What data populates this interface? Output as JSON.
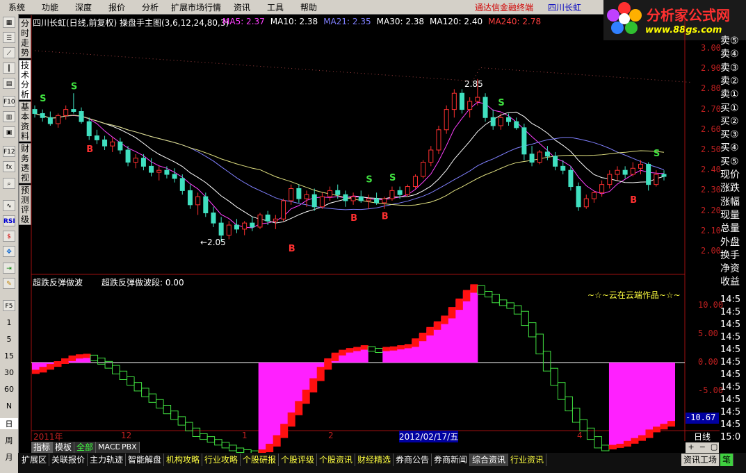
{
  "menu": [
    "系统",
    "功能",
    "深度",
    "报价",
    "分析",
    "扩展市场行情",
    "资讯",
    "工具",
    "帮助"
  ],
  "broker": "通达信金融终端",
  "stock_name": "四川长虹",
  "logo": {
    "title": "分析家公式网",
    "url": "www.88gs.com"
  },
  "main_header": {
    "title": "四川长虹(日线,前复权) 操盘手主图(3,6,12,24,80,3)",
    "ma": [
      {
        "label": "MA5: 2.37",
        "color": "#ff40ff"
      },
      {
        "label": "MA10: 2.38",
        "color": "#ffffff"
      },
      {
        "label": "MA21: 2.35",
        "color": "#8080ff"
      },
      {
        "label": "MA30: 2.38",
        "color": "#ffffff"
      },
      {
        "label": "MA120: 2.40",
        "color": "#ffffff"
      },
      {
        "label": "MA240: 2.78",
        "color": "#ff4040"
      }
    ]
  },
  "annotations": {
    "high": "2.85",
    "low": "←2.05"
  },
  "sub_header": {
    "name": "超跌反弹做波",
    "value_label": "超跌反弹做波段: 0.00",
    "watermark": "~☆~云在云端作品~☆~"
  },
  "price_axis": [
    "3.00",
    "2.90",
    "2.80",
    "2.70",
    "2.60",
    "2.50",
    "2.40",
    "2.30",
    "2.20",
    "2.10",
    "2.00"
  ],
  "sub_axis": [
    "10.00",
    "5.00",
    "0.00",
    "-5.00"
  ],
  "sub_axis_current": "-10.67",
  "dates": {
    "year": "2011年",
    "m12": "12",
    "m1": "1",
    "m2": "2",
    "cursor": "2012/02/17/五",
    "m4": "4"
  },
  "period": "日线",
  "right_side": [
    "卖⑤",
    "卖④",
    "卖③",
    "卖②",
    "卖①",
    "买①",
    "买②",
    "买③",
    "买④",
    "买⑤",
    "现价",
    "涨跌",
    "涨幅",
    "现量",
    "总量",
    "外盘",
    "换手",
    "净资",
    "收益"
  ],
  "right_time": [
    "14:5",
    "14:5",
    "14:5",
    "14:5",
    "14:5",
    "14:5",
    "14:5",
    "14:5",
    "14:5",
    "14:5",
    "14:5",
    "15:0"
  ],
  "vtabs": [
    "分时走势",
    "技术分析",
    "基本资料",
    "财务透视",
    "预测评级"
  ],
  "tb_nums": [
    "1",
    "5",
    "15",
    "30",
    "60",
    "N",
    "日",
    "周",
    "月"
  ],
  "ind_tabs": [
    "指标",
    "模板",
    "全部",
    "MACD",
    "PBX"
  ],
  "bottom_tabs": [
    "扩展区",
    "关联报价",
    "主力轨迹",
    "智能解盘",
    "机构攻略",
    "行业攻略",
    "个股研报",
    "个股评级",
    "个股资讯",
    "财经精选",
    "券商公告",
    "券商新闻",
    "综合资讯",
    "行业资讯"
  ],
  "bottom_right": "资讯工场",
  "bottom_right2": "笔",
  "candles": [
    [
      2.7,
      2.72,
      2.66,
      2.68
    ],
    [
      2.68,
      2.7,
      2.64,
      2.66
    ],
    [
      2.66,
      2.69,
      2.62,
      2.63
    ],
    [
      2.63,
      2.68,
      2.61,
      2.67
    ],
    [
      2.67,
      2.72,
      2.65,
      2.7
    ],
    [
      2.7,
      2.78,
      2.68,
      2.69
    ],
    [
      2.69,
      2.71,
      2.63,
      2.64
    ],
    [
      2.64,
      2.66,
      2.55,
      2.57
    ],
    [
      2.57,
      2.6,
      2.53,
      2.55
    ],
    [
      2.55,
      2.57,
      2.5,
      2.52
    ],
    [
      2.52,
      2.56,
      2.49,
      2.54
    ],
    [
      2.54,
      2.56,
      2.48,
      2.5
    ],
    [
      2.5,
      2.52,
      2.42,
      2.44
    ],
    [
      2.44,
      2.48,
      2.41,
      2.46
    ],
    [
      2.46,
      2.48,
      2.4,
      2.42
    ],
    [
      2.42,
      2.46,
      2.37,
      2.39
    ],
    [
      2.39,
      2.42,
      2.35,
      2.4
    ],
    [
      2.4,
      2.42,
      2.36,
      2.38
    ],
    [
      2.38,
      2.41,
      2.34,
      2.36
    ],
    [
      2.36,
      2.38,
      2.28,
      2.3
    ],
    [
      2.3,
      2.33,
      2.21,
      2.23
    ],
    [
      2.23,
      2.29,
      2.18,
      2.27
    ],
    [
      2.27,
      2.29,
      2.17,
      2.19
    ],
    [
      2.19,
      2.22,
      2.12,
      2.14
    ],
    [
      2.14,
      2.17,
      2.05,
      2.08
    ],
    [
      2.08,
      2.15,
      2.06,
      2.13
    ],
    [
      2.13,
      2.16,
      2.09,
      2.11
    ],
    [
      2.11,
      2.15,
      2.08,
      2.14
    ],
    [
      2.14,
      2.17,
      2.1,
      2.12
    ],
    [
      2.12,
      2.19,
      2.11,
      2.18
    ],
    [
      2.18,
      2.2,
      2.13,
      2.15
    ],
    [
      2.15,
      2.18,
      2.11,
      2.16
    ],
    [
      2.16,
      2.26,
      2.15,
      2.25
    ],
    [
      2.25,
      2.33,
      2.23,
      2.31
    ],
    [
      2.31,
      2.33,
      2.24,
      2.26
    ],
    [
      2.26,
      2.3,
      2.22,
      2.28
    ],
    [
      2.28,
      2.31,
      2.2,
      2.22
    ],
    [
      2.22,
      2.29,
      2.21,
      2.27
    ],
    [
      2.27,
      2.32,
      2.25,
      2.3
    ],
    [
      2.3,
      2.33,
      2.26,
      2.28
    ],
    [
      2.28,
      2.3,
      2.22,
      2.25
    ],
    [
      2.25,
      2.29,
      2.23,
      2.27
    ],
    [
      2.27,
      2.3,
      2.24,
      2.25
    ],
    [
      2.25,
      2.28,
      2.21,
      2.26
    ],
    [
      2.26,
      2.29,
      2.23,
      2.24
    ],
    [
      2.24,
      2.27,
      2.21,
      2.26
    ],
    [
      2.26,
      2.32,
      2.25,
      2.3
    ],
    [
      2.3,
      2.32,
      2.26,
      2.28
    ],
    [
      2.28,
      2.33,
      2.27,
      2.32
    ],
    [
      2.32,
      2.38,
      2.31,
      2.37
    ],
    [
      2.37,
      2.45,
      2.36,
      2.44
    ],
    [
      2.44,
      2.52,
      2.42,
      2.5
    ],
    [
      2.5,
      2.62,
      2.48,
      2.6
    ],
    [
      2.6,
      2.72,
      2.58,
      2.7
    ],
    [
      2.7,
      2.8,
      2.66,
      2.78
    ],
    [
      2.78,
      2.8,
      2.68,
      2.7
    ],
    [
      2.7,
      2.76,
      2.66,
      2.74
    ],
    [
      2.74,
      2.85,
      2.72,
      2.76
    ],
    [
      2.76,
      2.78,
      2.64,
      2.66
    ],
    [
      2.66,
      2.7,
      2.6,
      2.62
    ],
    [
      2.62,
      2.68,
      2.6,
      2.66
    ],
    [
      2.66,
      2.68,
      2.62,
      2.64
    ],
    [
      2.64,
      2.66,
      2.6,
      2.61
    ],
    [
      2.61,
      2.63,
      2.45,
      2.48
    ],
    [
      2.48,
      2.52,
      2.42,
      2.44
    ],
    [
      2.44,
      2.5,
      2.43,
      2.49
    ],
    [
      2.49,
      2.52,
      2.45,
      2.47
    ],
    [
      2.47,
      2.49,
      2.4,
      2.42
    ],
    [
      2.42,
      2.45,
      2.38,
      2.4
    ],
    [
      2.4,
      2.42,
      2.3,
      2.32
    ],
    [
      2.32,
      2.34,
      2.2,
      2.22
    ],
    [
      2.22,
      2.28,
      2.21,
      2.26
    ],
    [
      2.26,
      2.3,
      2.24,
      2.29
    ],
    [
      2.29,
      2.35,
      2.27,
      2.33
    ],
    [
      2.33,
      2.4,
      2.31,
      2.38
    ],
    [
      2.38,
      2.42,
      2.35,
      2.4
    ],
    [
      2.4,
      2.42,
      2.36,
      2.38
    ],
    [
      2.38,
      2.44,
      2.37,
      2.41
    ],
    [
      2.41,
      2.45,
      2.38,
      2.43
    ],
    [
      2.43,
      2.44,
      2.3,
      2.33
    ],
    [
      2.33,
      2.4,
      2.32,
      2.38
    ],
    [
      2.38,
      2.4,
      2.35,
      2.37
    ]
  ],
  "signals": {
    "S": [
      {
        "i": 1,
        "p": 2.74
      },
      {
        "i": 5,
        "p": 2.8
      },
      {
        "i": 43,
        "p": 2.34
      },
      {
        "i": 46,
        "p": 2.35
      },
      {
        "i": 60,
        "p": 2.72
      },
      {
        "i": 80,
        "p": 2.47
      }
    ],
    "B": [
      {
        "i": 7,
        "p": 2.49
      },
      {
        "i": 33,
        "p": 2.0
      },
      {
        "i": 41,
        "p": 2.15
      },
      {
        "i": 45,
        "p": 2.16
      },
      {
        "i": 77,
        "p": 2.24
      }
    ]
  },
  "sub_values": [
    -1.5,
    -1,
    -0.5,
    0,
    0.5,
    1,
    1.2,
    1.3,
    0.8,
    0.2,
    -0.5,
    -1.5,
    -2.5,
    -3.5,
    -4.5,
    -5.5,
    -6.5,
    -7.5,
    -8.5,
    -9.5,
    -10.5,
    -11.5,
    -12.5,
    -13,
    -13.5,
    -14,
    -14.5,
    -15,
    -15.3,
    -15.5,
    -15.8,
    -15.5,
    -14.5,
    -13,
    -11,
    -9,
    -7,
    -5,
    -3,
    -1,
    0.5,
    1.5,
    2,
    2.3,
    2.5,
    2.8,
    2.5,
    2.3,
    2.5,
    2.6,
    2.8,
    3,
    4,
    5,
    6,
    7,
    8,
    9.5,
    11,
    12.5,
    13.5,
    12.5,
    12,
    11,
    10.5,
    10,
    9,
    7,
    5,
    2,
    -1,
    -3.5,
    -6,
    -8,
    -10,
    -11.5,
    -13,
    -14.5,
    -15,
    -14.7,
    -14.5,
    -14,
    -13.5,
    -13,
    -12,
    -11.5,
    -11,
    -10.5
  ]
}
